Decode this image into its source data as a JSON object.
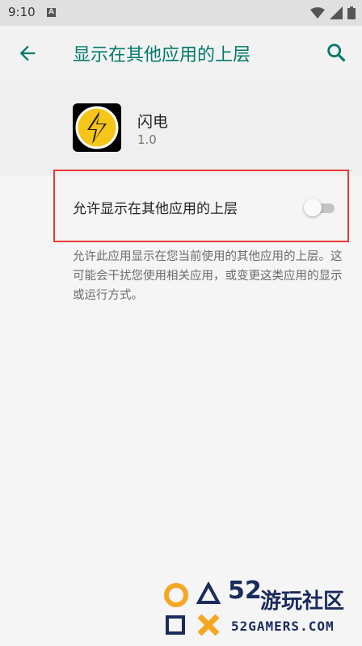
{
  "status_bar": {
    "time": "9:10",
    "a_icon": "A",
    "icons": [
      "wifi-icon",
      "signal-icon",
      "battery-icon"
    ]
  },
  "app_bar": {
    "title": "显示在其他应用的上层",
    "back_icon": "arrow-back-icon",
    "search_icon": "search-icon"
  },
  "app_info": {
    "name": "闪电",
    "version": "1.0"
  },
  "preference": {
    "label": "允许显示在其他应用的上层",
    "switch_on": false
  },
  "description": "允许此应用显示在您当前使用的其他应用的上层。这可能会干扰您使用相关应用，或变更这类应用的显示或运行方式。",
  "watermark": {
    "number": "52",
    "name": "游玩社区",
    "domain": "52GAMERS.COM"
  },
  "colors": {
    "accent": "#00796b",
    "highlight_border": "#e53935",
    "watermark": "#1a2b5c",
    "logo_yellow": "#f5c518"
  }
}
